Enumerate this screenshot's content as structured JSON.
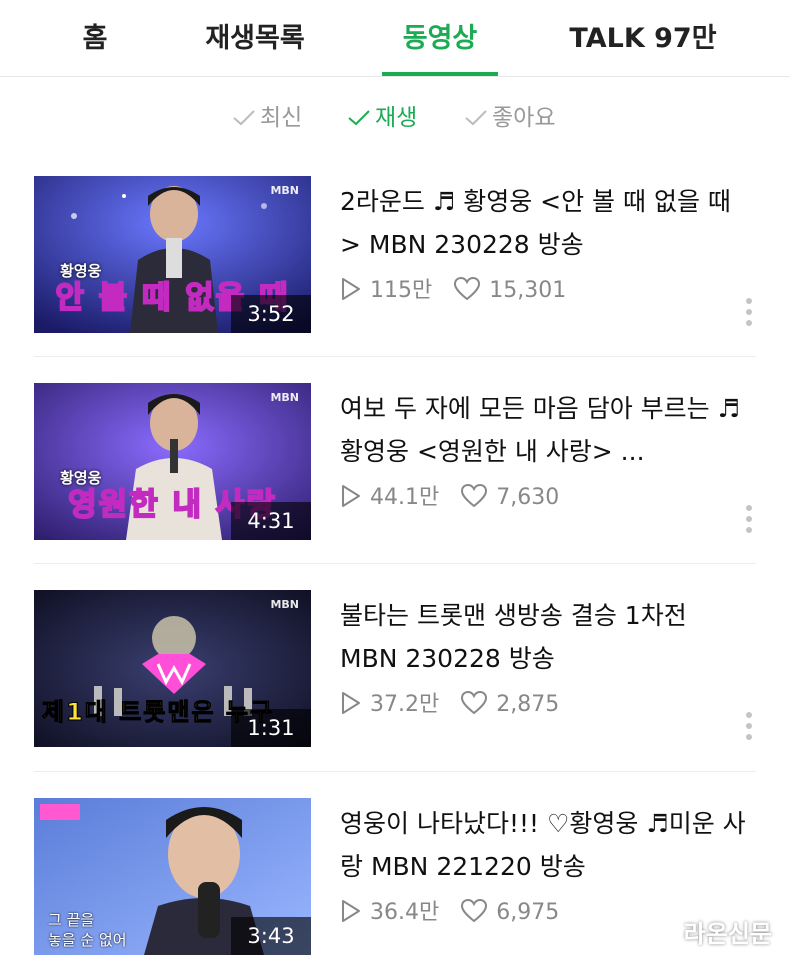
{
  "tabs": [
    {
      "label": "홈"
    },
    {
      "label": "재생목록"
    },
    {
      "label": "동영상"
    },
    {
      "label": "TALK 97만"
    }
  ],
  "sort": [
    {
      "label": "최신"
    },
    {
      "label": "재생"
    },
    {
      "label": "좋아요"
    }
  ],
  "videos": [
    {
      "title": "2라운드 ♬ 황영웅 <안 볼 때 없을 때> MBN 230228 방송",
      "views": "115만",
      "likes": "15,301",
      "duration": "3:52",
      "thumb_logo": "MBN",
      "thumb_singer": "황영웅",
      "thumb_caption": "안 볼 때 없을 때"
    },
    {
      "title": "여보 두 자에 모든 마음 담아 부르는 ♬황영웅 <영원한 내 사랑> ...",
      "views": "44.1만",
      "likes": "7,630",
      "duration": "4:31",
      "thumb_logo": "MBN",
      "thumb_singer": "황영웅",
      "thumb_caption": "영원한 내 사랑"
    },
    {
      "title": "불타는 트롯맨 생방송 결승 1차전 MBN 230228 방송",
      "views": "37.2만",
      "likes": "2,875",
      "duration": "1:31",
      "thumb_logo": "MBN",
      "thumb_caption": "제1대 트롯맨은 누구"
    },
    {
      "title": "영웅이 나타났다!!! ♡황영웅 ♬미운 사랑 MBN 221220 방송",
      "views": "36.4만",
      "likes": "6,975",
      "duration": "3:43",
      "thumb_sub_1": "그 끝을",
      "thumb_sub_2": "놓을 순 없어"
    }
  ],
  "watermark": "라온신문",
  "colors": {
    "accent": "#1bab53",
    "inactive": "#999999",
    "caption_stroke": "#c32bc0"
  }
}
